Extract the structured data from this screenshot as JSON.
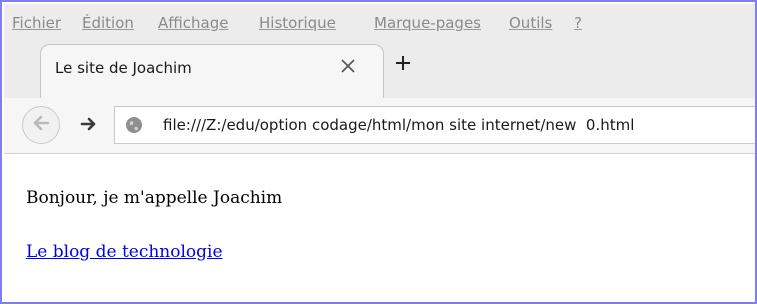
{
  "menubar": {
    "items": [
      {
        "label": "Fichier"
      },
      {
        "label": "Édition"
      },
      {
        "label": "Affichage"
      },
      {
        "label": "Historique"
      },
      {
        "label": "Marque-pages"
      },
      {
        "label": "Outils"
      },
      {
        "label": "?"
      }
    ]
  },
  "tabs": [
    {
      "title": "Le site de Joachim",
      "active": true
    }
  ],
  "toolbar": {
    "url": "file:///Z:/edu/option codage/html/mon site internet/new  0.html"
  },
  "icons": {
    "back": "back-arrow-icon",
    "forward": "forward-arrow-icon",
    "site": "globe-icon",
    "close_tab": "close-icon",
    "new_tab": "plus-icon"
  },
  "page": {
    "paragraph": "Bonjour, je m'appelle Joachim",
    "link_text": "Le blog de technologie"
  },
  "colors": {
    "link": "#0000ee",
    "frame_border": "#7e7ef0",
    "chrome_bg": "#ececec"
  }
}
